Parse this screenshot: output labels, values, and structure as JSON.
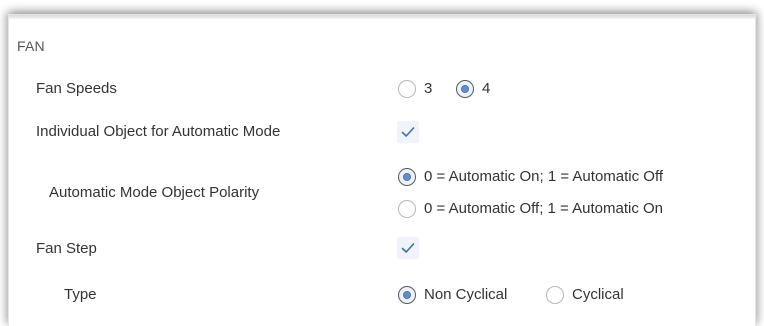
{
  "section": {
    "title": "FAN"
  },
  "fan_speeds": {
    "label": "Fan Speeds",
    "options": [
      "3",
      "4"
    ],
    "selected": "4"
  },
  "individual_object": {
    "label": "Individual Object for Automatic Mode",
    "checked": true
  },
  "automatic_polarity": {
    "label": "Automatic Mode Object Polarity",
    "options": [
      "0 = Automatic On; 1 = Automatic Off",
      "0 = Automatic Off; 1 = Automatic On"
    ],
    "selected": "0 = Automatic On; 1 = Automatic Off"
  },
  "fan_step": {
    "label": "Fan Step",
    "checked": true
  },
  "type": {
    "label": "Type",
    "options": [
      "Non Cyclical",
      "Cyclical"
    ],
    "selected": "Non Cyclical"
  },
  "colors": {
    "accent": "#5f8fcf",
    "check_bg": "#f0f4fa"
  }
}
